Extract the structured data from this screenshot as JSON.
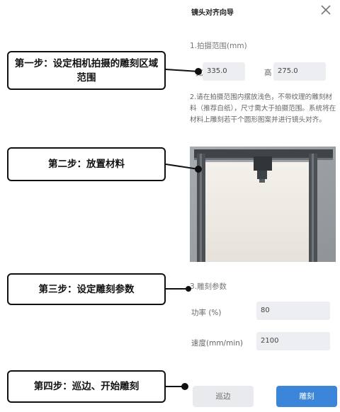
{
  "dialog": {
    "title": "镜头对齐向导",
    "section1_title": "1.拍摄范围(mm)",
    "width_label": "宽",
    "width_value": "335.0",
    "height_label": "高",
    "height_value": "275.0",
    "description": "2.请在拍摄范围内摆放浅色，不带纹理的雕刻材料（推荐白纸），尺寸需大于拍摄范围。系统将在材料上雕刻若干个圆形图案并进行镜头对齐。",
    "section3_title": "3.雕刻参数",
    "power_label": "功率 (%)",
    "power_value": "80",
    "speed_label": "速度(mm/min)",
    "speed_value": "2100",
    "trace_button": "巡边",
    "engrave_button": "雕刻"
  },
  "callouts": {
    "step1": "第一步：设定相机拍摄的雕刻区域范围",
    "step2": "第二步：放置材料",
    "step3": "第三步：设定雕刻参数",
    "step4": "第四步：巡边、开始雕刻"
  },
  "colors": {
    "primary": "#3b86d9",
    "input_bg": "#eceef1",
    "callout_border": "#111111"
  }
}
